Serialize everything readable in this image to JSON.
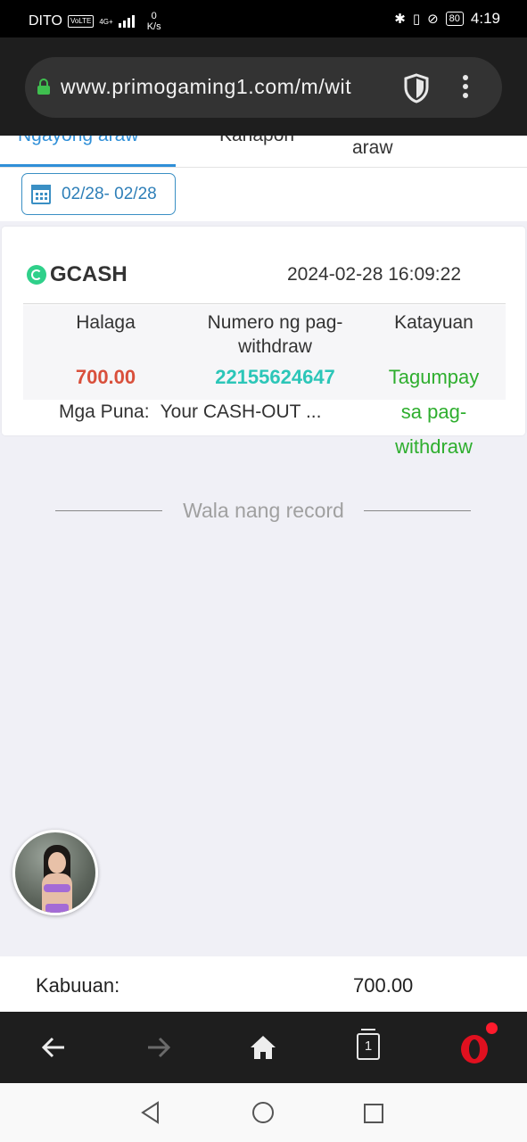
{
  "status_bar": {
    "carrier": "DITO",
    "volte": "VoLTE",
    "network": "4G+",
    "speed_value": "0",
    "speed_unit": "K/s",
    "battery": "80",
    "time": "4:19"
  },
  "browser": {
    "url": "www.primogaming1.com/m/wit"
  },
  "tabs": {
    "today": "Ngayong araw",
    "yesterday": "Kahapon",
    "week": "araw",
    "more": "-"
  },
  "date_filter": {
    "label": "02/28- 02/28"
  },
  "record": {
    "method": "GCASH",
    "datetime": "2024-02-28 16:09:22",
    "headers": {
      "amount": "Halaga",
      "number_line1": "Numero ng pag-",
      "number_line2": "withdraw",
      "status": "Katayuan"
    },
    "amount": "700.00",
    "withdraw_number": "22155624647",
    "status_line1": "Tagumpay",
    "status_line2": "sa pag-",
    "status_line3": "withdraw",
    "remarks_label": "Mga Puna:",
    "remarks_value": "Your CASH-OUT ..."
  },
  "no_more_text": "Wala nang record",
  "total": {
    "label": "Kabuuan:",
    "value": "700.00"
  },
  "bottom_nav": {
    "tab_count": "1"
  },
  "colors": {
    "accent_blue": "#2f8fd8",
    "amount_red": "#d9503c",
    "number_teal": "#2cc6b8",
    "status_green": "#2eae2e",
    "opera_red": "#ff1b2d"
  }
}
